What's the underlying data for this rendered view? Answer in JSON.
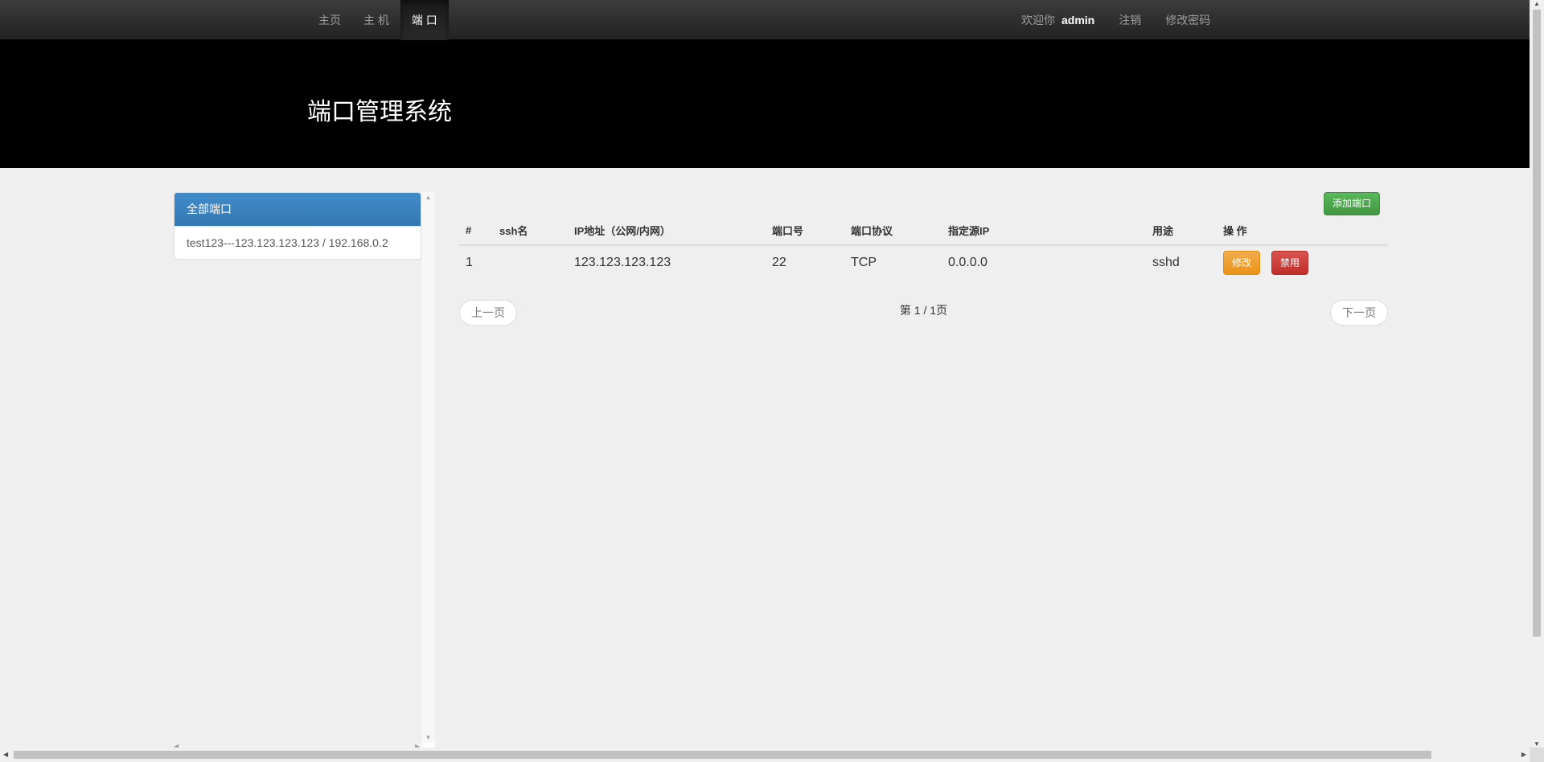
{
  "navbar": {
    "items": [
      {
        "label": "主页",
        "active": false
      },
      {
        "label": "主 机",
        "active": false
      },
      {
        "label": "端 口",
        "active": true
      }
    ],
    "welcome": "欢迎你",
    "username": "admin",
    "logout": "注销",
    "change_password": "修改密码"
  },
  "hero": {
    "title": "端口管理系统"
  },
  "sidebar": {
    "items": [
      {
        "label": "全部端口",
        "active": true
      },
      {
        "label": "test123---123.123.123.123 / 192.168.0.2",
        "active": false
      }
    ]
  },
  "main": {
    "add_button": "添加端口",
    "table": {
      "headers": [
        "#",
        "ssh名",
        "IP地址（公网/内网）",
        "端口号",
        "端口协议",
        "指定源IP",
        "用途",
        "操 作"
      ],
      "rows": [
        {
          "index": "1",
          "ssh_name": "",
          "ip": "123.123.123.123",
          "port": "22",
          "protocol": "TCP",
          "source_ip": "0.0.0.0",
          "purpose": "sshd"
        }
      ],
      "edit_label": "修改",
      "disable_label": "禁用"
    },
    "pager": {
      "prev": "上一页",
      "info": "第 1 / 1页",
      "next": "下一页"
    }
  },
  "colors": {
    "navbar_bg": "#222222",
    "hero_bg": "#000000",
    "primary": "#428bca",
    "success": "#5cb85c",
    "warning": "#f0ad4e",
    "danger": "#d9534f",
    "page_bg": "#efefef"
  }
}
